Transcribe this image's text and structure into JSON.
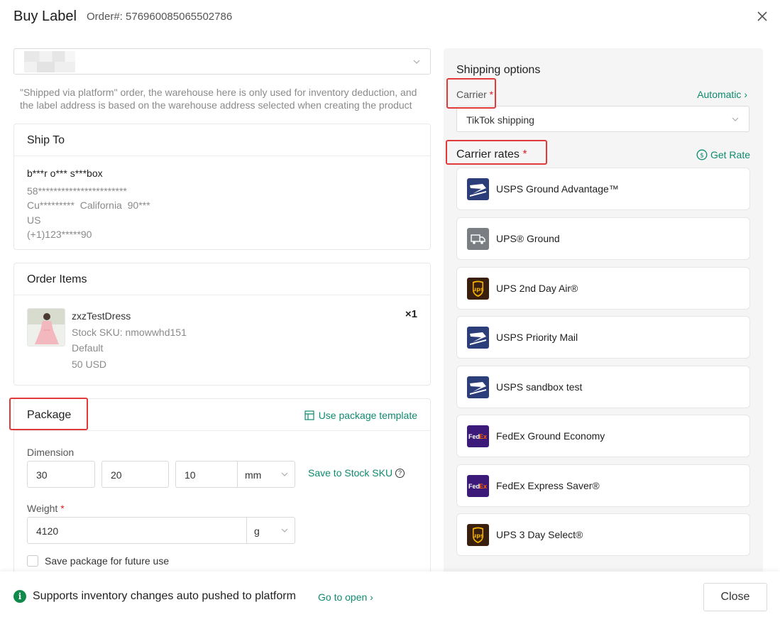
{
  "header": {
    "title": "Buy Label",
    "order_label": "Order#: 576960085065502786"
  },
  "warehouse": {
    "hint": "\"Shipped via platform\" order, the warehouse here is only used for inventory deduction, and the label address is based on the warehouse address selected when creating the product"
  },
  "ship_to": {
    "title": "Ship To",
    "name": "b***r o*** s***box",
    "address_line": "58***********************",
    "city_line": "Cu*********  California  90***",
    "country": "US",
    "phone": "(+1)123*****90"
  },
  "order_items": {
    "title": "Order Items",
    "items": [
      {
        "name": "zxzTestDress",
        "sku": "Stock SKU: nmowwhd151",
        "variant": "Default",
        "price": "50 USD",
        "qty": "×1"
      }
    ]
  },
  "package": {
    "title": "Package",
    "template_link": "Use package template",
    "dimension_label": "Dimension",
    "length": "30",
    "width": "20",
    "height": "10",
    "dimension_unit": "mm",
    "save_to_sku": "Save to Stock SKU",
    "weight_label": "Weight",
    "weight": "4120",
    "weight_unit": "g",
    "save_future": "Save package for future use"
  },
  "shipping": {
    "title": "Shipping options",
    "carrier_label": "Carrier",
    "automatic": "Automatic",
    "carrier_value": "TikTok shipping",
    "rates_title": "Carrier rates",
    "get_rate": "Get Rate",
    "rates": [
      {
        "name": "USPS Ground Advantage™",
        "icon": "usps-icon"
      },
      {
        "name": "UPS® Ground",
        "icon": "truck-icon"
      },
      {
        "name": "UPS 2nd Day Air®",
        "icon": "ups-icon"
      },
      {
        "name": "USPS Priority Mail",
        "icon": "usps-icon"
      },
      {
        "name": "USPS sandbox test",
        "icon": "usps-icon"
      },
      {
        "name": "FedEx Ground Economy",
        "icon": "fedex-icon"
      },
      {
        "name": "FedEx Express Saver®",
        "icon": "fedex-icon"
      },
      {
        "name": "UPS 3 Day Select®",
        "icon": "ups-icon"
      }
    ]
  },
  "footer": {
    "notice": "Supports inventory changes auto pushed to platform",
    "go_open": "Go to open",
    "close_label": "Close"
  },
  "colors": {
    "accent": "#0f8a6e",
    "required": "#e02020",
    "highlight": "#e03a3a"
  }
}
